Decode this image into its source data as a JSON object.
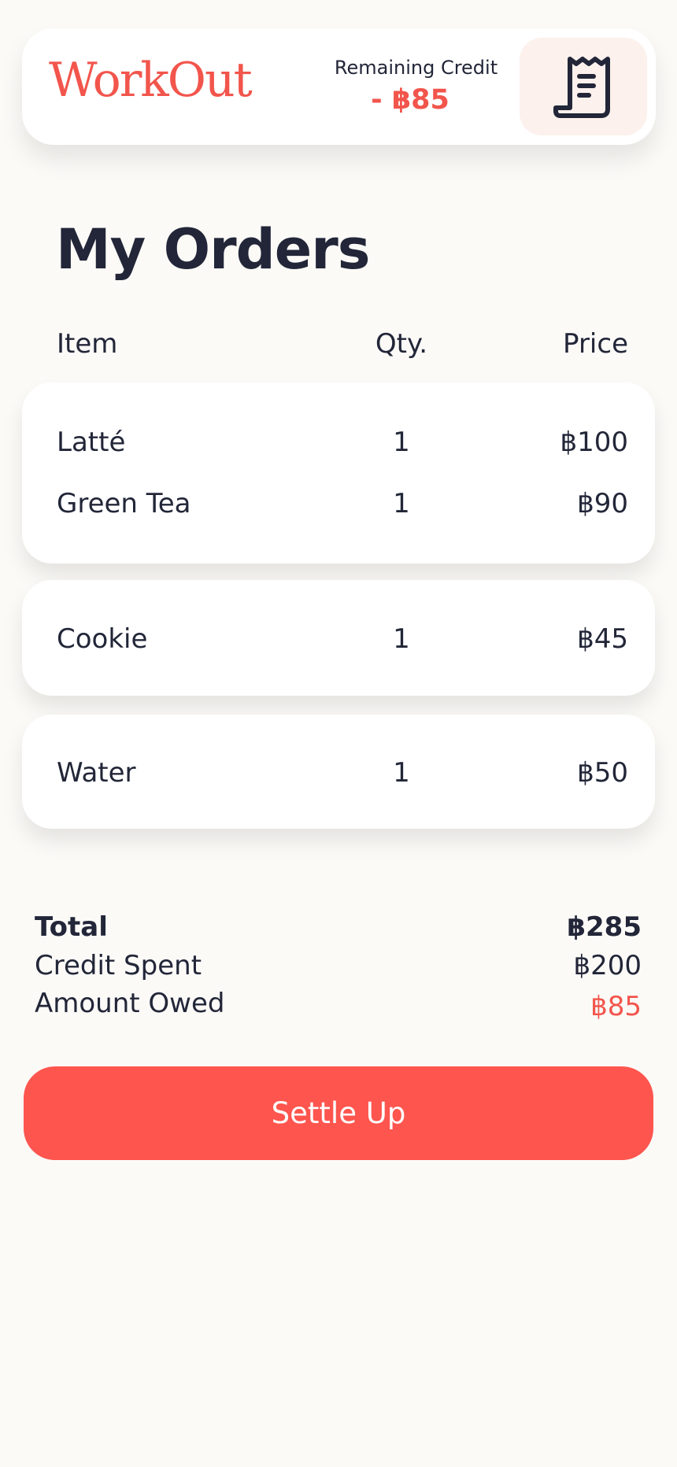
{
  "header": {
    "logo": "WorkOut",
    "credit_label": "Remaining Credit",
    "credit_value": "- ฿85",
    "receipt_icon": "receipt-icon"
  },
  "page_title": "My Orders",
  "columns": {
    "item": "Item",
    "qty": "Qty.",
    "price": "Price"
  },
  "orders": [
    {
      "items": [
        {
          "name": "Latté",
          "qty": "1",
          "price": "฿100"
        },
        {
          "name": "Green Tea",
          "qty": "1",
          "price": "฿90"
        }
      ]
    },
    {
      "items": [
        {
          "name": "Cookie",
          "qty": "1",
          "price": "฿45"
        }
      ]
    },
    {
      "items": [
        {
          "name": "Water",
          "qty": "1",
          "price": "฿50"
        }
      ]
    }
  ],
  "summary": {
    "total_label": "Total",
    "total_value": "฿285",
    "credit_spent_label": "Credit Spent",
    "credit_spent_value": "฿200",
    "amount_owed_label": "Amount Owed",
    "amount_owed_value": "฿85"
  },
  "settle_button": "Settle Up",
  "colors": {
    "accent": "#f2554c",
    "button": "#fe554e",
    "text": "#222638",
    "background": "#fbfaf7"
  }
}
